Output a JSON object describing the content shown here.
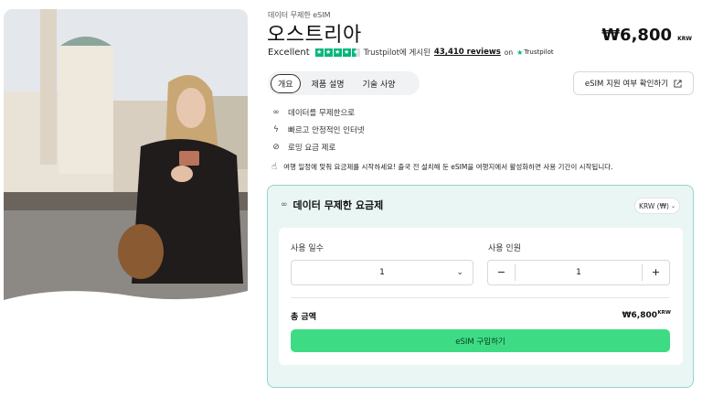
{
  "product": {
    "kicker": "데이터 무제한 eSIM",
    "title": "오스트리아",
    "price": "₩6,800",
    "price_currency": "KRW"
  },
  "rating": {
    "label": "Excellent",
    "stars": 4.5,
    "trustpilot_text": "Trustpilot에 게시된",
    "reviews": "43,410 reviews",
    "on": "on",
    "brand": "Trustpilot"
  },
  "tabs": [
    {
      "label": "개요",
      "active": true
    },
    {
      "label": "제품 설명",
      "active": false
    },
    {
      "label": "기술 사양",
      "active": false
    }
  ],
  "check_button": {
    "label": "eSIM 지원 여부 확인하기",
    "icon": "external-link-icon"
  },
  "features": [
    {
      "icon": "infinity-icon",
      "label": "데이터를 무제한으로"
    },
    {
      "icon": "bolt-icon",
      "label": "빠르고 안정적인 인터넷"
    },
    {
      "icon": "no-roaming-icon",
      "label": "로밍 요금 제로"
    }
  ],
  "notice": {
    "icon": "hand-tap-icon",
    "text": "여행 일정에 맞춰 요금제를 시작하세요! 출국 전 설치해 둔 eSIM을 여행지에서 활성화하면 사용 기간이 시작됩니다."
  },
  "plan": {
    "title": "데이터 무제한 요금제",
    "currency_select": "KRW (₩)",
    "days_label": "사용 일수",
    "days_value": "1",
    "people_label": "사용 인원",
    "people_value": "1",
    "minus": "−",
    "plus": "+",
    "total_label": "총 금액",
    "total_value": "₩6,800",
    "total_currency": "KRW",
    "buy_label": "eSIM 구입하기"
  },
  "colors": {
    "accent": "#3ddc84",
    "panel": "#eaf6f4",
    "trustpilot": "#00b67a"
  }
}
